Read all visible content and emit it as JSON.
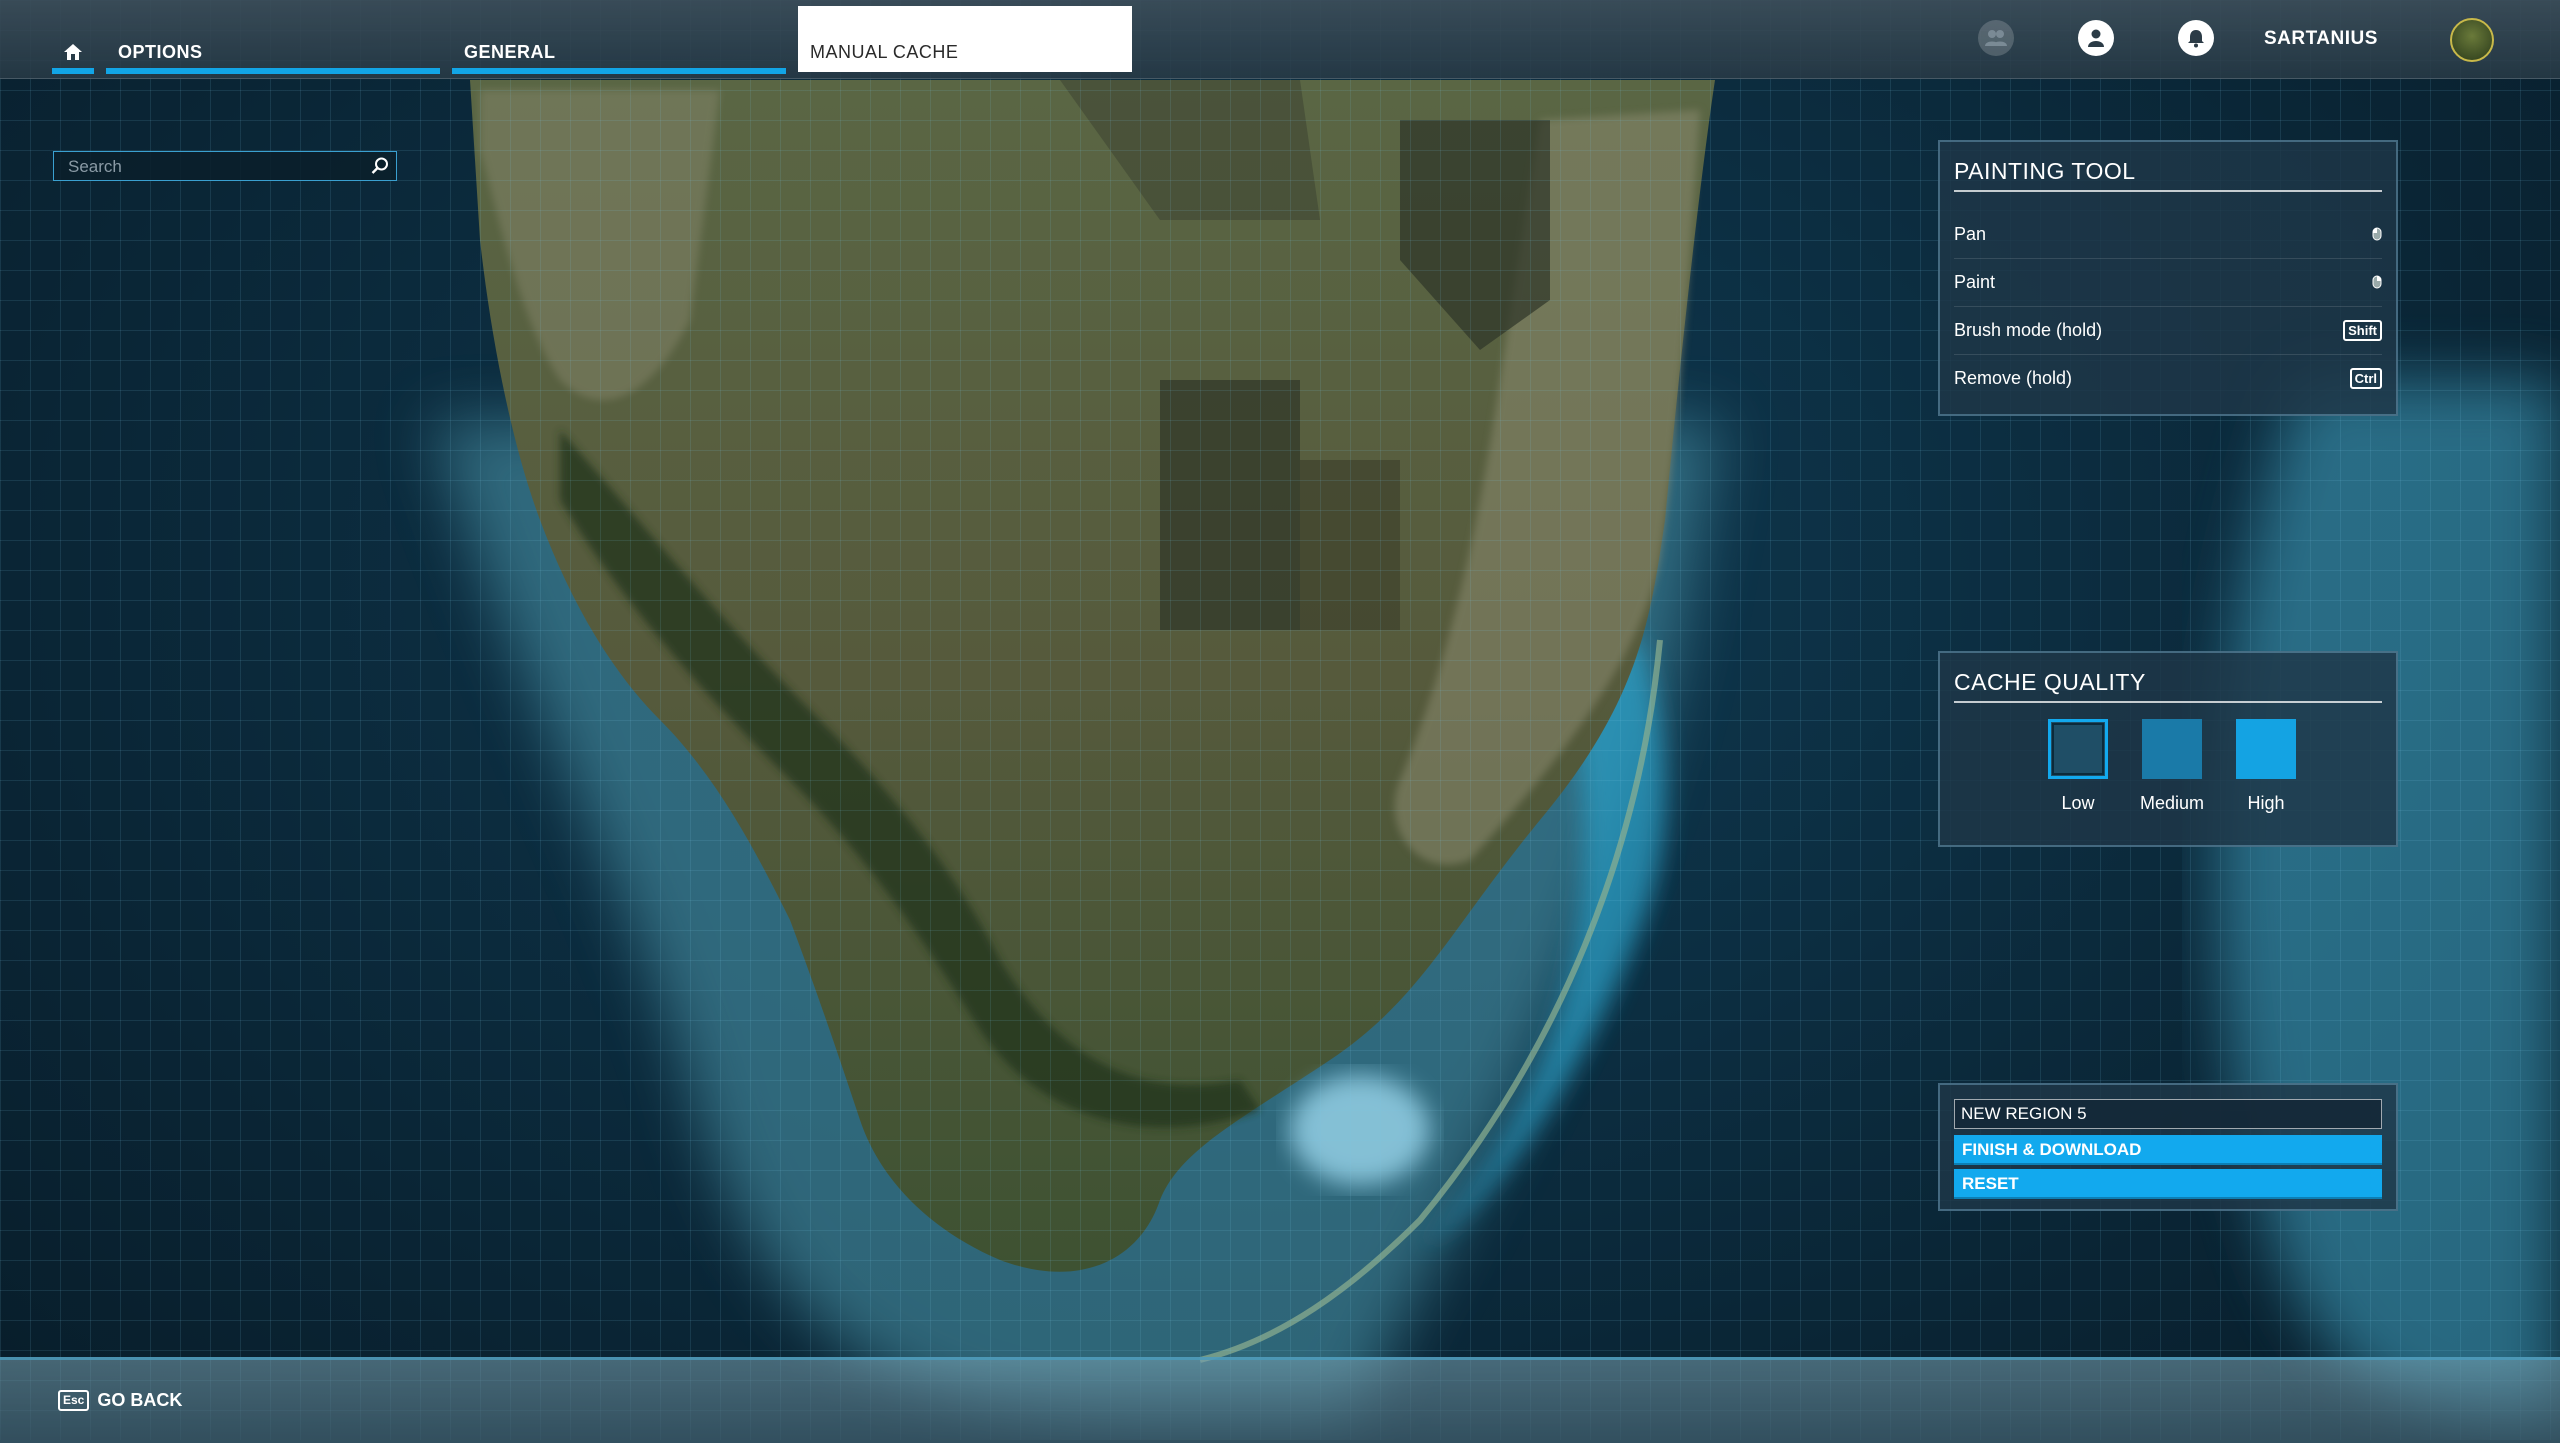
{
  "header": {
    "tabs": [
      {
        "label": "OPTIONS",
        "active": false
      },
      {
        "label": "GENERAL",
        "active": false
      },
      {
        "label": "MANUAL CACHE",
        "active": true
      }
    ],
    "icons": [
      "friends-icon",
      "profile-icon",
      "notification-bell-icon"
    ],
    "username": "SARTANIUS"
  },
  "search": {
    "placeholder": "Search"
  },
  "painting_tool": {
    "title": "PAINTING TOOL",
    "rows": [
      {
        "label": "Pan",
        "control": "mouse-left-icon"
      },
      {
        "label": "Paint",
        "control": "mouse-right-icon"
      },
      {
        "label": "Brush mode (hold)",
        "key": "Shift"
      },
      {
        "label": "Remove (hold)",
        "key": "Ctrl"
      }
    ]
  },
  "cache_quality": {
    "title": "CACHE QUALITY",
    "options": [
      {
        "label": "Low",
        "color": "#1f4e66",
        "selected": true
      },
      {
        "label": "Medium",
        "color": "#1a7aa8",
        "selected": false
      },
      {
        "label": "High",
        "color": "#14a3e3",
        "selected": false
      }
    ]
  },
  "region": {
    "name": "NEW REGION 5",
    "finish_label": "FINISH & DOWNLOAD",
    "reset_label": "RESET"
  },
  "footer": {
    "back_key": "Esc",
    "back_label": "GO BACK"
  },
  "colors": {
    "accent": "#12a9ee"
  }
}
